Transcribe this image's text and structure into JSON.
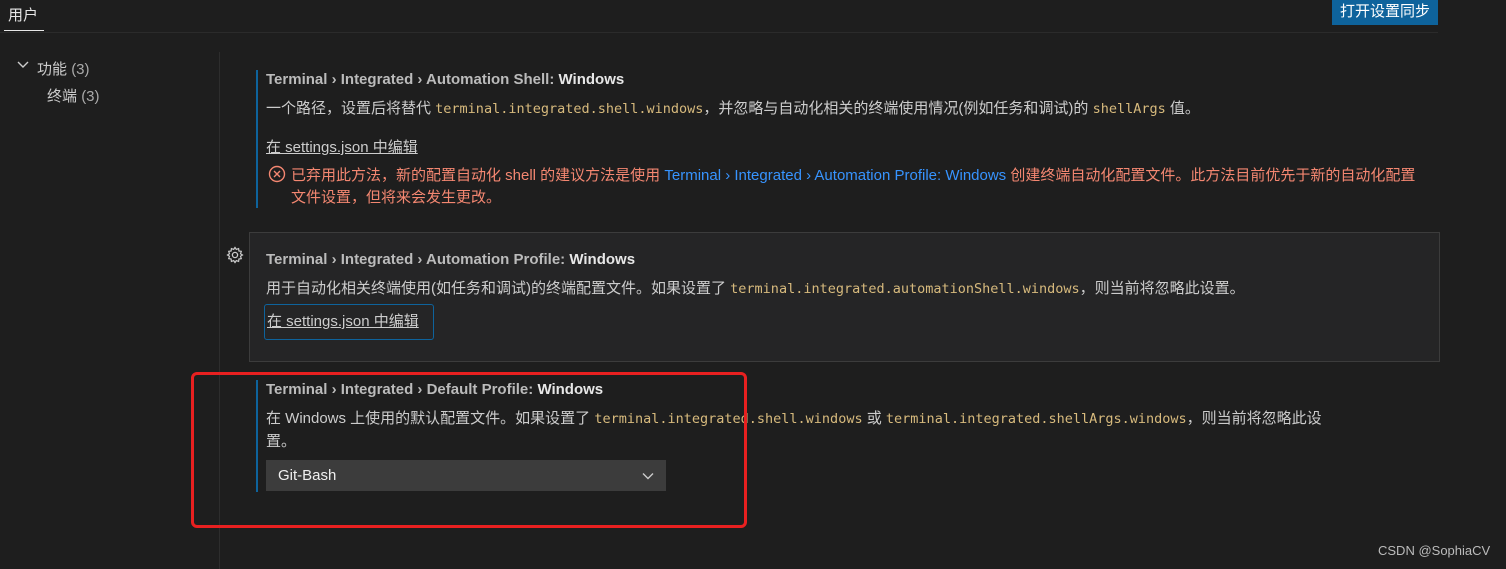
{
  "header": {
    "tab_label": "用户",
    "sync_button": "打开设置同步"
  },
  "toc": {
    "items": [
      {
        "label": "功能",
        "count": "(3)"
      },
      {
        "label": "终端",
        "count": "(3)"
      }
    ]
  },
  "settings": [
    {
      "category": "Terminal › Integrated › Automation Shell:",
      "name": "Windows",
      "desc_prefix": "一个路径，设置后将替代 ",
      "desc_code1": "terminal.integrated.shell.windows",
      "desc_mid": "，并忽略与自动化相关的终端使用情况(例如任务和调试)的 ",
      "desc_code2": "shellArgs",
      "desc_suffix": " 值。",
      "link": "在 settings.json 中编辑",
      "deprecation": {
        "prefix": "已弃用此方法，新的配置自动化 shell 的建议方法是使用 ",
        "ref": "Terminal › Integrated › Automation Profile: Windows",
        "suffix": " 创建终端自动化配置文件。此方法目前优先于新的自动化配置文件设置，但将来会发生更改。"
      }
    },
    {
      "category": "Terminal › Integrated › Automation Profile:",
      "name": "Windows",
      "desc_prefix": "用于自动化相关终端使用(如任务和调试)的终端配置文件。如果设置了 ",
      "desc_code1": "terminal.integrated.automationShell.windows",
      "desc_suffix": "，则当前将忽略此设置。",
      "link": "在 settings.json 中编辑"
    },
    {
      "category": "Terminal › Integrated › Default Profile:",
      "name": "Windows",
      "desc_prefix": "在 Windows 上使用的默认配置文件。如果设置了 ",
      "desc_code1": "terminal.integrated.shell.windows",
      "desc_mid": " 或 ",
      "desc_code2": "terminal.integrated.shellArgs.windows",
      "desc_suffix": "，则当前将忽略此设",
      "desc_line2": "置。",
      "dropdown_value": "Git-Bash"
    }
  ],
  "watermark": "CSDN @SophiaCV",
  "colors": {
    "accent": "#0e639c",
    "deprecation": "#f48771",
    "link_ref": "#3794ff",
    "code": "#d7ba7d",
    "highlight_box": "#e82020"
  },
  "icons": [
    "chevron-down-icon",
    "error-circle-icon",
    "gear-icon"
  ]
}
